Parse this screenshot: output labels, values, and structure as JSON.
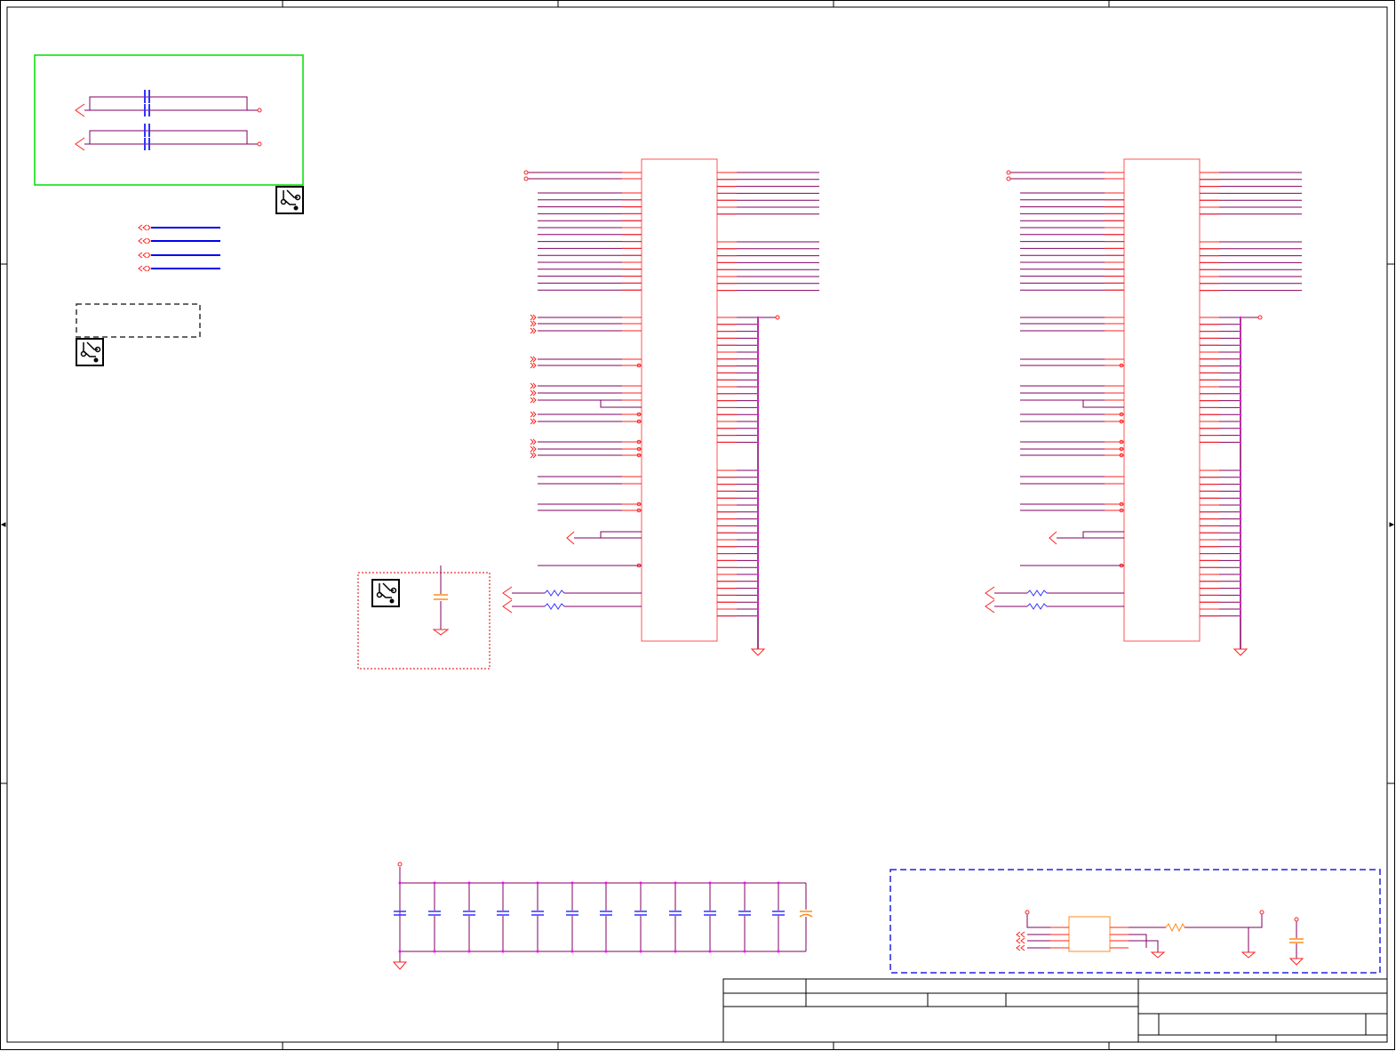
{
  "colors": {
    "border": "#000000",
    "pin": "#ff2020",
    "wire": "#800060",
    "net": "#0000ee",
    "power": "#ff0000",
    "component_outline": "#ff5555",
    "passive": "#3333ff",
    "orange_part": "#ff8c1a",
    "green_box": "#00dd00",
    "blue_box": "#2222dd",
    "red_box": "#dd0000",
    "grey_box": "#333333",
    "junction": "#ff00ff"
  },
  "icons": [
    "pcb-logo-icon",
    "pcb-logo-icon",
    "pcb-logo-icon"
  ],
  "title_block": {
    "fields": []
  }
}
